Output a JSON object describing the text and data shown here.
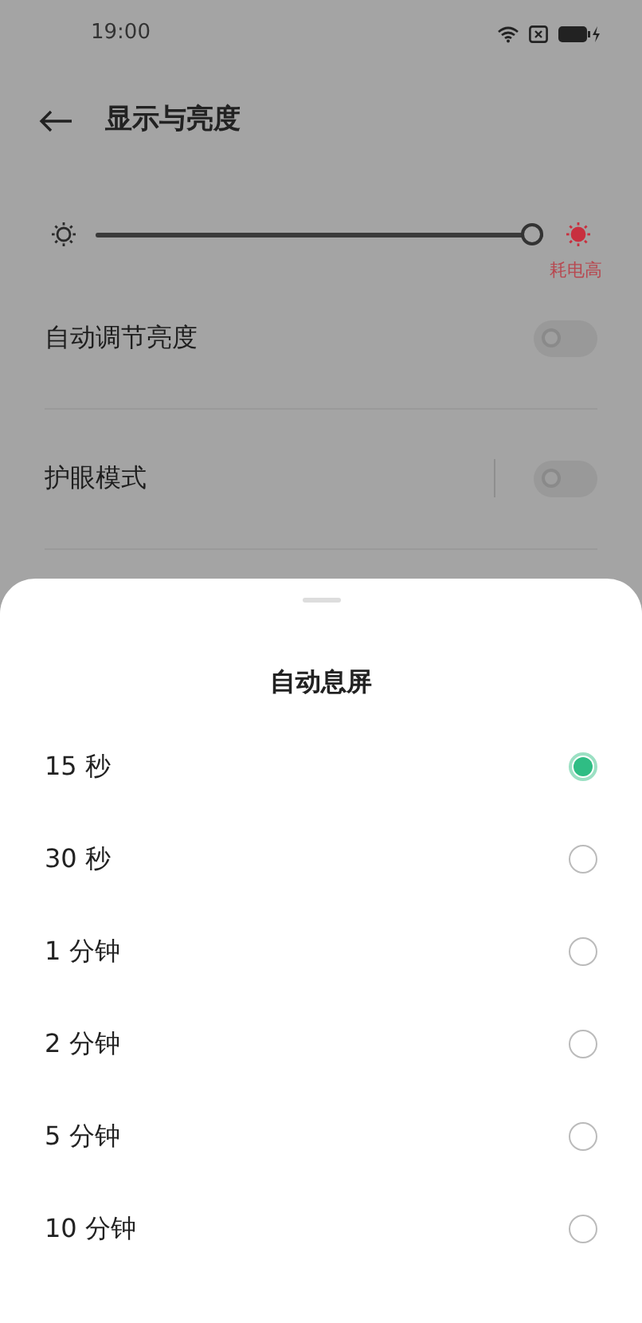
{
  "status_bar": {
    "time": "19:00"
  },
  "header": {
    "title": "显示与亮度"
  },
  "brightness": {
    "level": 1,
    "note": "耗电高"
  },
  "settings": [
    {
      "label": "自动调节亮度",
      "on": false
    },
    {
      "label": "护眼模式",
      "on": false
    }
  ],
  "sheet": {
    "title": "自动息屏",
    "options": [
      {
        "label": "15 秒",
        "selected": true
      },
      {
        "label": "30 秒",
        "selected": false
      },
      {
        "label": "1 分钟",
        "selected": false
      },
      {
        "label": "2 分钟",
        "selected": false
      },
      {
        "label": "5 分钟",
        "selected": false
      },
      {
        "label": "10 分钟",
        "selected": false
      }
    ]
  }
}
